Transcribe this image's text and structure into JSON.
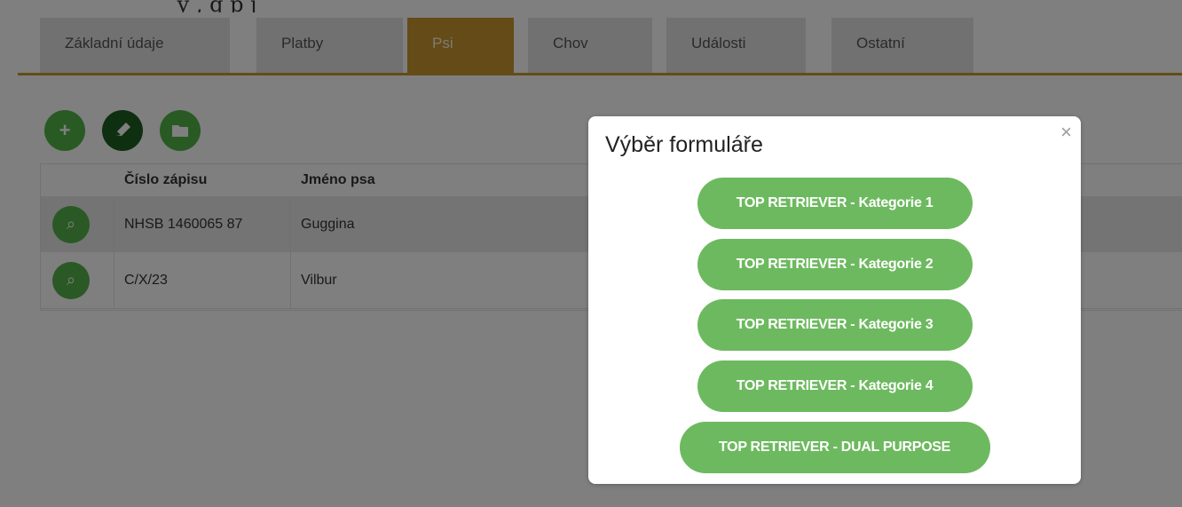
{
  "top_fragment": "_      ý     ,                                        g                            p          j",
  "tabs": [
    "Základní údaje",
    "Platby",
    "Psi",
    "Chov",
    "Události",
    "Ostatní"
  ],
  "table": {
    "headers": [
      "Číslo zápisu",
      "Jméno psa"
    ],
    "rows": [
      {
        "registration": "NHSB 1460065 87",
        "name": "Guggina"
      },
      {
        "registration": "C/X/23",
        "name": "Vilbur"
      }
    ]
  },
  "modal": {
    "title": "Výběr formuláře",
    "close_label": "×",
    "options": [
      "TOP RETRIEVER - Kategorie 1",
      "TOP RETRIEVER - Kategorie 2",
      "TOP RETRIEVER - Kategorie 3",
      "TOP RETRIEVER - Kategorie 4",
      "TOP RETRIEVER - DUAL PURPOSE"
    ]
  },
  "colors": {
    "accent": "#c99631",
    "green": "#53b448",
    "modal_green": "#6db95f"
  },
  "icons": {
    "add": "plus-icon",
    "edit": "pencil-icon",
    "folder": "folder-icon",
    "search": "search-icon",
    "close": "close-icon"
  }
}
